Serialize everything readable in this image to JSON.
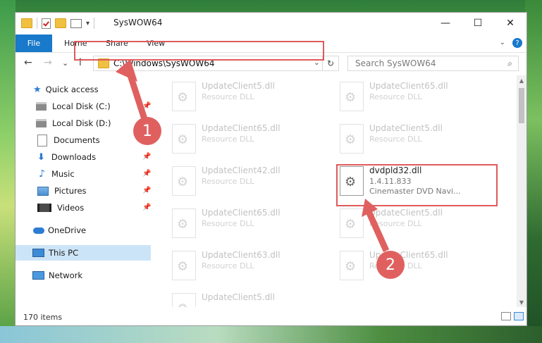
{
  "window": {
    "title": "SysWOW64",
    "caption": {
      "minimize": "—",
      "maximize": "☐",
      "close": "✕"
    }
  },
  "ribbon": {
    "tabs": [
      "File",
      "Home",
      "Share",
      "View"
    ],
    "help": "?"
  },
  "navigation": {
    "back": "←",
    "forward": "→",
    "recent": "⌄",
    "up": "↑",
    "address": "C:\\Windows\\SysWOW64",
    "search_placeholder": "Search SysWOW64"
  },
  "sidebar": {
    "items": [
      {
        "label": "Quick access",
        "icon": "star-icon"
      },
      {
        "label": "Local Disk (C:)",
        "icon": "drive-icon",
        "pinned": true
      },
      {
        "label": "Local Disk (D:)",
        "icon": "drive-icon",
        "pinned": true
      },
      {
        "label": "Documents",
        "icon": "documents-icon",
        "pinned": true
      },
      {
        "label": "Downloads",
        "icon": "download-icon",
        "pinned": true
      },
      {
        "label": "Music",
        "icon": "music-icon",
        "pinned": true
      },
      {
        "label": "Pictures",
        "icon": "pictures-icon",
        "pinned": true
      },
      {
        "label": "Videos",
        "icon": "videos-icon",
        "pinned": true
      },
      {
        "label": "OneDrive",
        "icon": "cloud-icon"
      },
      {
        "label": "This PC",
        "icon": "pc-icon",
        "selected": true
      },
      {
        "label": "Network",
        "icon": "network-icon"
      }
    ]
  },
  "files": [
    {
      "name": "UpdateClient5.dll",
      "sub": "Resource DLL"
    },
    {
      "name": "UpdateClient65.dll",
      "sub": "Resource DLL"
    },
    {
      "name": "UpdateClient65.dll",
      "sub": "Resource DLL"
    },
    {
      "name": "UpdateClient5.dll",
      "sub": "Resource DLL"
    },
    {
      "name": "UpdateClient42.dll",
      "sub": "Resource DLL"
    },
    {
      "name": "dvdpld32.dll",
      "sub": "1.4.11.833",
      "sub2": "Cinemaster DVD Navi...",
      "highlighted": true
    },
    {
      "name": "UpdateClient65.dll",
      "sub": "Resource DLL"
    },
    {
      "name": "UpdateClient5.dll",
      "sub": "Resource DLL"
    },
    {
      "name": "UpdateClient63.dll",
      "sub": "Resource DLL"
    },
    {
      "name": "UpdateClient65.dll",
      "sub": "Resource DLL"
    },
    {
      "name": "UpdateClient5.dll",
      "sub": "Resource DLL"
    }
  ],
  "status": {
    "item_count": "170 items"
  },
  "annotations": {
    "step1": "1",
    "step2": "2",
    "color": "#e05a5a"
  }
}
